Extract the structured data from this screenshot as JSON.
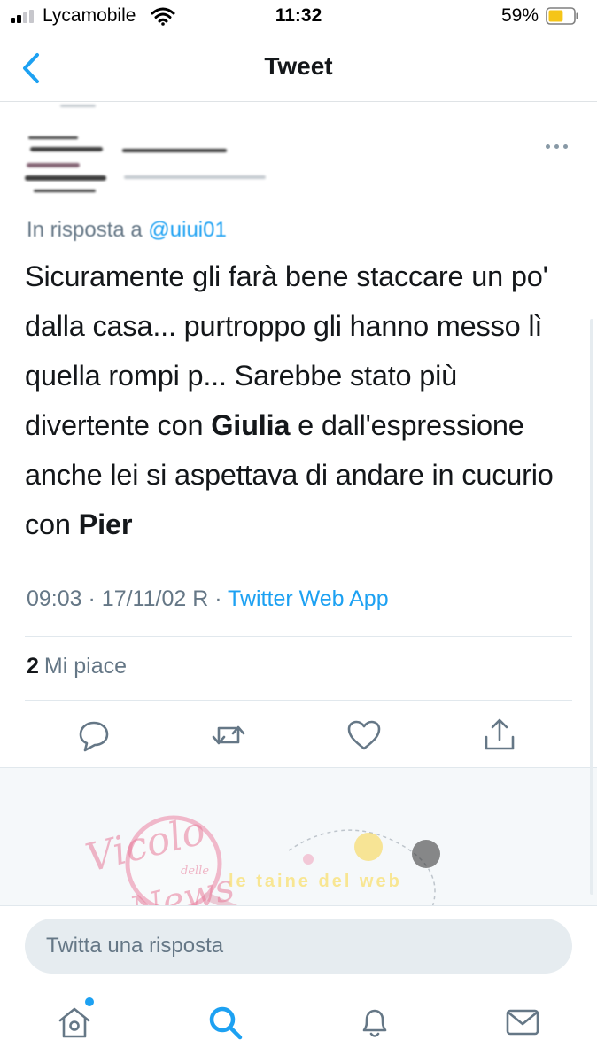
{
  "status_bar": {
    "carrier": "Lycamobile",
    "time": "11:32",
    "battery_percent": "59%",
    "battery_level": 0.59,
    "battery_color": "#f5c518",
    "signal_bars_filled": 2
  },
  "nav": {
    "title": "Tweet",
    "back_icon": "chevron-left-icon"
  },
  "tweet": {
    "reply_to_prefix": "In risposta a",
    "reply_to_handle": "@uiui01",
    "text_parts": {
      "p1": "Sicuramente gli farà bene staccare un po' dalla casa... purtroppo gli hanno messo lì quella rompi p... Sarebbe stato più divertente con ",
      "bold1": "Giulia",
      "p2": " e dall'espressione anche lei si aspettava di andare in cucurio con ",
      "bold2": "Pier"
    },
    "time": "09:03",
    "date": "17/11/02 R",
    "separator": "·",
    "source": "Twitter Web App",
    "likes_count": "2",
    "likes_label": "Mi piace"
  },
  "actions": {
    "reply_icon": "comment-icon",
    "retweet_icon": "retweet-icon",
    "like_icon": "heart-icon",
    "share_icon": "share-icon"
  },
  "composer": {
    "placeholder": "Twitta una risposta"
  },
  "tab_bar": {
    "items": [
      "home-icon",
      "search-icon",
      "notifications-icon",
      "messages-icon"
    ],
    "active": "search-icon",
    "active_color": "#1da1f2",
    "inactive_color": "#657786"
  },
  "watermark": {
    "line1": "Vicolo",
    "line2": "delle",
    "line3": "News",
    "banner": "le taine del web"
  },
  "colors": {
    "accent": "#1da1f2",
    "text": "#14171a",
    "secondary": "#657786"
  }
}
